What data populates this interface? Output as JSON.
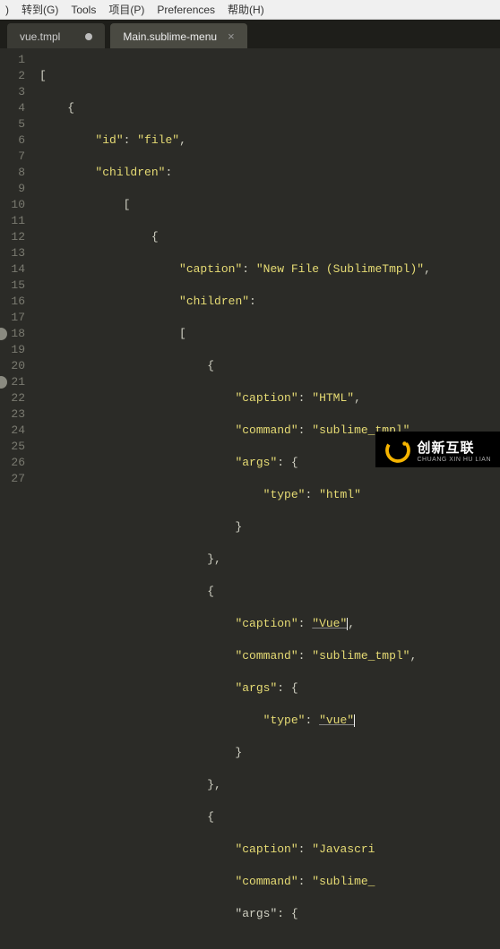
{
  "menu": {
    "partial": ")",
    "items": [
      "转到(G)",
      "Tools",
      "项目(P)",
      "Preferences",
      "帮助(H)"
    ]
  },
  "tabs": [
    {
      "label": "vue.tmpl",
      "active": false,
      "dirty": true
    },
    {
      "label": "Main.sublime-menu",
      "active": true,
      "dirty": false
    }
  ],
  "lines": {
    "start": 1,
    "end": 27,
    "marks": [
      18,
      21
    ]
  },
  "code": {
    "l1": "[",
    "l2": "    {",
    "l3a": "        ",
    "l3k": "\"id\"",
    "l3p": ": ",
    "l3v": "\"file\"",
    "l3e": ",",
    "l4a": "        ",
    "l4k": "\"children\"",
    "l4p": ":",
    "l5": "            [",
    "l6": "                {",
    "l7a": "                    ",
    "l7k": "\"caption\"",
    "l7p": ": ",
    "l7v": "\"New File (SublimeTmpl)\"",
    "l7e": ",",
    "l8a": "                    ",
    "l8k": "\"children\"",
    "l8p": ":",
    "l9": "                    [",
    "l10": "                        {",
    "l11a": "                            ",
    "l11k": "\"caption\"",
    "l11p": ": ",
    "l11v": "\"HTML\"",
    "l11e": ",",
    "l12a": "                            ",
    "l12k": "\"command\"",
    "l12p": ": ",
    "l12v": "\"sublime_tmpl\"",
    "l12e": ",",
    "l13a": "                            ",
    "l13k": "\"args\"",
    "l13p": ": {",
    "l14a": "                                ",
    "l14k": "\"type\"",
    "l14p": ": ",
    "l14v": "\"html\"",
    "l15": "                            }",
    "l16": "                        },",
    "l17": "                        {",
    "l18a": "                            ",
    "l18k": "\"caption\"",
    "l18p": ": ",
    "l18v": "\"Vue\"",
    "l18e": ",",
    "l19a": "                            ",
    "l19k": "\"command\"",
    "l19p": ": ",
    "l19v": "\"sublime_tmpl\"",
    "l19e": ",",
    "l20a": "                            ",
    "l20k": "\"args\"",
    "l20p": ": {",
    "l21a": "                                ",
    "l21k": "\"type\"",
    "l21p": ": ",
    "l21v": "\"vue\"",
    "l22": "                            }",
    "l23": "                        },",
    "l24": "                        {",
    "l25a": "                            ",
    "l25k": "\"caption\"",
    "l25p": ": ",
    "l25v": "\"Javascri",
    "l26a": "                            ",
    "l26k": "\"command\"",
    "l26p": ": ",
    "l26v": "\"sublime_",
    "l27": "                            \"args\": {"
  },
  "logo": {
    "brand": "创新互联",
    "sub": "CHUANG XIN HU LIAN"
  }
}
